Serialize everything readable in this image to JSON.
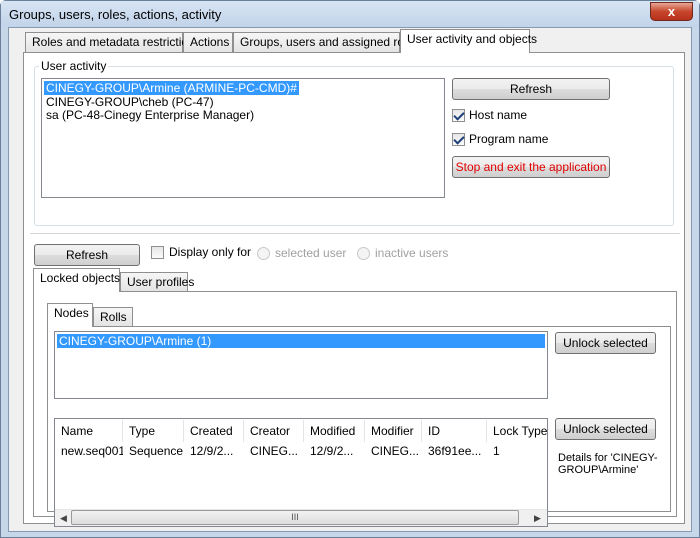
{
  "window": {
    "title": "Groups, users, roles, actions, activity",
    "close_glyph": "x"
  },
  "top_tabs": [
    {
      "label": "Roles and metadata restrictions"
    },
    {
      "label": "Actions"
    },
    {
      "label": "Groups, users and assigned roles"
    },
    {
      "label": "User activity and objects"
    }
  ],
  "user_activity": {
    "group_label": "User activity",
    "items": [
      "CINEGY-GROUP\\Armine (ARMINE-PC-CMD)#",
      "CINEGY-GROUP\\cheb (PC-47)",
      "sa (PC-48-Cinegy Enterprise Manager)"
    ],
    "refresh_label": "Refresh",
    "host_name_label": "Host name",
    "program_name_label": "Program name",
    "stop_exit_label": "Stop and exit the application"
  },
  "filter_bar": {
    "refresh_label": "Refresh",
    "display_only_label": "Display only for",
    "selected_user_label": "selected user",
    "inactive_users_label": "inactive users"
  },
  "lower_tabs": [
    {
      "label": "Locked objects"
    },
    {
      "label": "User profiles"
    }
  ],
  "inner_tabs": [
    {
      "label": "Nodes"
    },
    {
      "label": "Rolls"
    }
  ],
  "nodes": {
    "items": [
      "CINEGY-GROUP\\Armine (1)"
    ],
    "unlock_label": "Unlock selected"
  },
  "objects_table": {
    "columns": [
      "Name",
      "Type",
      "Created",
      "Creator",
      "Modified",
      "Modifier",
      "ID",
      "Lock Type"
    ],
    "rows": [
      [
        "new.seq001",
        "Sequence",
        "12/9/2...",
        "CINEG...",
        "12/9/2...",
        "CINEG...",
        "36f91ee...",
        "1"
      ]
    ],
    "unlock_label": "Unlock selected",
    "details_text": "Details for 'CINEGY-GROUP\\Armine'",
    "scroll_grip": "III"
  }
}
